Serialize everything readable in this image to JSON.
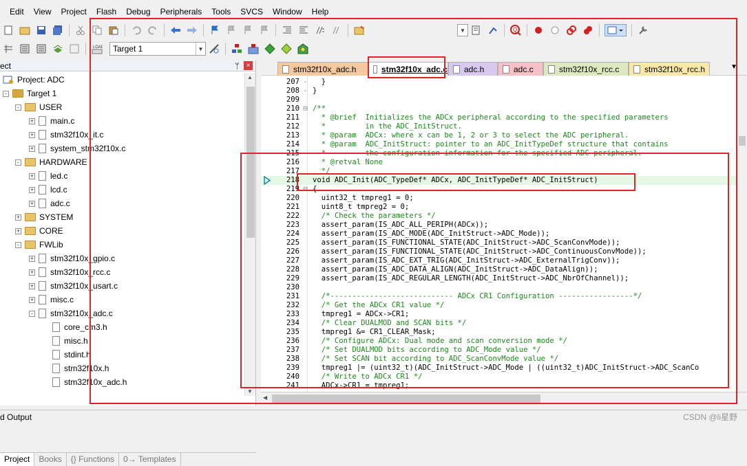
{
  "menu": [
    "Edit",
    "View",
    "Project",
    "Flash",
    "Debug",
    "Peripherals",
    "Tools",
    "SVCS",
    "Window",
    "Help"
  ],
  "toolbar": {
    "target_combo": "Target 1"
  },
  "project_panel": {
    "title": "ect",
    "tree": [
      {
        "label": "Project: ADC",
        "kind": "project",
        "indent": 0,
        "expand": ""
      },
      {
        "label": "Target 1",
        "kind": "target",
        "indent": 1,
        "expand": "-"
      },
      {
        "label": "USER",
        "kind": "folder",
        "indent": 2,
        "expand": "-"
      },
      {
        "label": "main.c",
        "kind": "file",
        "indent": 3,
        "expand": "+"
      },
      {
        "label": "stm32f10x_it.c",
        "kind": "file",
        "indent": 3,
        "expand": "+"
      },
      {
        "label": "system_stm32f10x.c",
        "kind": "file",
        "indent": 3,
        "expand": "+"
      },
      {
        "label": "HARDWARE",
        "kind": "folder",
        "indent": 2,
        "expand": "-"
      },
      {
        "label": "led.c",
        "kind": "file",
        "indent": 3,
        "expand": "+"
      },
      {
        "label": "lcd.c",
        "kind": "file",
        "indent": 3,
        "expand": "+"
      },
      {
        "label": "adc.c",
        "kind": "file",
        "indent": 3,
        "expand": "+"
      },
      {
        "label": "SYSTEM",
        "kind": "folder",
        "indent": 2,
        "expand": "+"
      },
      {
        "label": "CORE",
        "kind": "folder",
        "indent": 2,
        "expand": "+"
      },
      {
        "label": "FWLib",
        "kind": "folder",
        "indent": 2,
        "expand": "-"
      },
      {
        "label": "stm32f10x_gpio.c",
        "kind": "file",
        "indent": 3,
        "expand": "+"
      },
      {
        "label": "stm32f10x_rcc.c",
        "kind": "file",
        "indent": 3,
        "expand": "+"
      },
      {
        "label": "stm32f10x_usart.c",
        "kind": "file",
        "indent": 3,
        "expand": "+"
      },
      {
        "label": "misc.c",
        "kind": "file",
        "indent": 3,
        "expand": "+"
      },
      {
        "label": "stm32f10x_adc.c",
        "kind": "file",
        "indent": 3,
        "expand": "-"
      },
      {
        "label": "core_cm3.h",
        "kind": "file",
        "indent": 4,
        "expand": ""
      },
      {
        "label": "misc.h",
        "kind": "file",
        "indent": 4,
        "expand": ""
      },
      {
        "label": "stdint.h",
        "kind": "file",
        "indent": 4,
        "expand": ""
      },
      {
        "label": "stm32f10x.h",
        "kind": "file",
        "indent": 4,
        "expand": ""
      },
      {
        "label": "stm32f10x_adc.h",
        "kind": "file",
        "indent": 4,
        "expand": ""
      }
    ],
    "bottom_tabs": [
      "Project",
      "Books",
      "{} Functions",
      "0→ Templates"
    ]
  },
  "editor": {
    "tabs": [
      {
        "label": "stm32f10x_adc.h",
        "color": "#f5c9a0"
      },
      {
        "label": "stm32f10x_adc.c",
        "color": "#d6ead0",
        "active": true
      },
      {
        "label": "adc.h",
        "color": "#d8c8f0"
      },
      {
        "label": "adc.c",
        "color": "#f5c0c8"
      },
      {
        "label": "stm32f10x_rcc.c",
        "color": "#dde8c0"
      },
      {
        "label": "stm32f10x_rcc.h",
        "color": "#f8e8a8"
      }
    ],
    "lines": [
      {
        "n": "207",
        "f": "-",
        "t": "  }",
        "c": ""
      },
      {
        "n": "208",
        "f": "-",
        "t": "}",
        "c": ""
      },
      {
        "n": "209",
        "f": "",
        "t": "",
        "c": ""
      },
      {
        "n": "210",
        "f": "⊟",
        "t": "/**",
        "c": "cm"
      },
      {
        "n": "211",
        "f": "",
        "t": "  * @brief  Initializes the ADCx peripheral according to the specified parameters",
        "c": "cm"
      },
      {
        "n": "212",
        "f": "",
        "t": "  *         in the ADC_InitStruct.",
        "c": "cm"
      },
      {
        "n": "213",
        "f": "",
        "t": "  * @param  ADCx: where x can be 1, 2 or 3 to select the ADC peripheral.",
        "c": "cm"
      },
      {
        "n": "214",
        "f": "",
        "t": "  * @param  ADC_InitStruct: pointer to an ADC_InitTypeDef structure that contains",
        "c": "cm"
      },
      {
        "n": "215",
        "f": "",
        "t": "  *         the configuration information for the specified ADC peripheral.",
        "c": "cm"
      },
      {
        "n": "216",
        "f": "",
        "t": "  * @retval None",
        "c": "cm"
      },
      {
        "n": "217",
        "f": "",
        "t": "  */",
        "c": "cm"
      },
      {
        "n": "218",
        "f": "",
        "t": "void ADC_Init(ADC_TypeDef* ADCx, ADC_InitTypeDef* ADC_InitStruct)",
        "c": "hl"
      },
      {
        "n": "219",
        "f": "⊟",
        "t": "{",
        "c": ""
      },
      {
        "n": "220",
        "f": "",
        "t": "  uint32_t tmpreg1 = 0;",
        "c": ""
      },
      {
        "n": "221",
        "f": "",
        "t": "  uint8_t tmpreg2 = 0;",
        "c": ""
      },
      {
        "n": "222",
        "f": "",
        "t": "  /* Check the parameters */",
        "c": "cm"
      },
      {
        "n": "223",
        "f": "",
        "t": "  assert_param(IS_ADC_ALL_PERIPH(ADCx));",
        "c": ""
      },
      {
        "n": "224",
        "f": "",
        "t": "  assert_param(IS_ADC_MODE(ADC_InitStruct->ADC_Mode));",
        "c": ""
      },
      {
        "n": "225",
        "f": "",
        "t": "  assert_param(IS_FUNCTIONAL_STATE(ADC_InitStruct->ADC_ScanConvMode));",
        "c": ""
      },
      {
        "n": "226",
        "f": "",
        "t": "  assert_param(IS_FUNCTIONAL_STATE(ADC_InitStruct->ADC_ContinuousConvMode));",
        "c": ""
      },
      {
        "n": "227",
        "f": "",
        "t": "  assert_param(IS_ADC_EXT_TRIG(ADC_InitStruct->ADC_ExternalTrigConv));",
        "c": ""
      },
      {
        "n": "228",
        "f": "",
        "t": "  assert_param(IS_ADC_DATA_ALIGN(ADC_InitStruct->ADC_DataAlign));",
        "c": ""
      },
      {
        "n": "229",
        "f": "",
        "t": "  assert_param(IS_ADC_REGULAR_LENGTH(ADC_InitStruct->ADC_NbrOfChannel));",
        "c": ""
      },
      {
        "n": "230",
        "f": "",
        "t": "",
        "c": ""
      },
      {
        "n": "231",
        "f": "",
        "t": "  /*---------------------------- ADCx CR1 Configuration -----------------*/",
        "c": "cm"
      },
      {
        "n": "232",
        "f": "",
        "t": "  /* Get the ADCx CR1 value */",
        "c": "cm"
      },
      {
        "n": "233",
        "f": "",
        "t": "  tmpreg1 = ADCx->CR1;",
        "c": ""
      },
      {
        "n": "234",
        "f": "",
        "t": "  /* Clear DUALMOD and SCAN bits */",
        "c": "cm"
      },
      {
        "n": "235",
        "f": "",
        "t": "  tmpreg1 &= CR1_CLEAR_Mask;",
        "c": ""
      },
      {
        "n": "236",
        "f": "",
        "t": "  /* Configure ADCx: Dual mode and scan conversion mode */",
        "c": "cm"
      },
      {
        "n": "237",
        "f": "",
        "t": "  /* Set DUALMOD bits according to ADC_Mode value */",
        "c": "cm"
      },
      {
        "n": "238",
        "f": "",
        "t": "  /* Set SCAN bit according to ADC_ScanConvMode value */",
        "c": "cm"
      },
      {
        "n": "239",
        "f": "",
        "t": "  tmpreg1 |= (uint32_t)(ADC_InitStruct->ADC_Mode | ((uint32_t)ADC_InitStruct->ADC_ScanCo",
        "c": ""
      },
      {
        "n": "240",
        "f": "",
        "t": "  /* Write to ADCx CR1 */",
        "c": "cm"
      },
      {
        "n": "241",
        "f": "",
        "t": "  ADCx->CR1 = tmpreg1;",
        "c": ""
      }
    ]
  },
  "status": {
    "output_label": "d Output"
  },
  "watermark": "CSDN @li星野"
}
